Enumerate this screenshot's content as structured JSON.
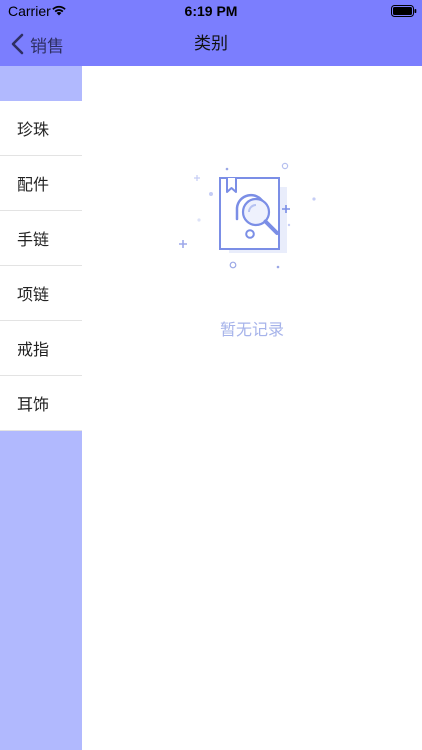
{
  "status_bar": {
    "carrier": "Carrier",
    "time": "6:19 PM",
    "icons": [
      "wifi-icon",
      "battery-icon"
    ]
  },
  "nav": {
    "back_label": "销售",
    "title": "类别",
    "back_icon": "chevron-left-icon"
  },
  "sidebar": {
    "items": [
      {
        "label": "珍珠"
      },
      {
        "label": "配件"
      },
      {
        "label": "手链"
      },
      {
        "label": "项链"
      },
      {
        "label": "戒指"
      },
      {
        "label": "耳饰"
      }
    ]
  },
  "empty_state": {
    "message": "暂无记录",
    "icon": "empty-document-search-icon"
  },
  "colors": {
    "header_bg": "#7b7efe",
    "sidebar_bg": "#b1b9fe",
    "empty_text": "#a6b3ea"
  }
}
